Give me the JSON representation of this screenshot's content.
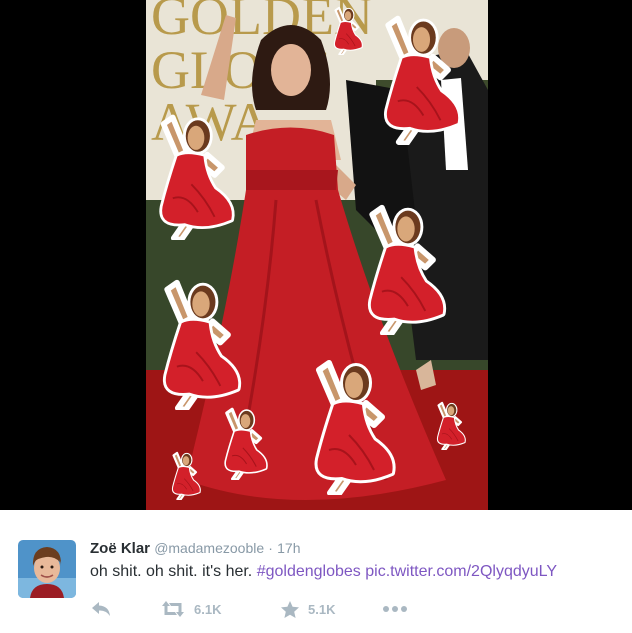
{
  "tweet": {
    "author_name": "Zoë Klar",
    "handle": "@madamezooble",
    "separator": "·",
    "time": "17h",
    "text_plain": "oh shit. oh shit. it's her. ",
    "hashtag": "#goldenglobes",
    "pic_link": "pic.twitter.com/2QlyqdyuLY",
    "retweet_count": "6.1K",
    "favorite_count": "5.1K"
  },
  "media": {
    "backdrop_text_lines": [
      "GOLDEN",
      "GLOBE",
      "AWA"
    ]
  },
  "icons": {
    "reply": "reply-icon",
    "retweet": "retweet-icon",
    "favorite": "star-icon",
    "more": "more-icon",
    "sticker": "dancer-emoji-icon"
  },
  "colors": {
    "link_purple": "#7e57c2",
    "muted_gray": "#8899a6",
    "action_gray": "#aab8c2",
    "dress_red": "#c41e25",
    "carpet_red": "#9e1515"
  }
}
